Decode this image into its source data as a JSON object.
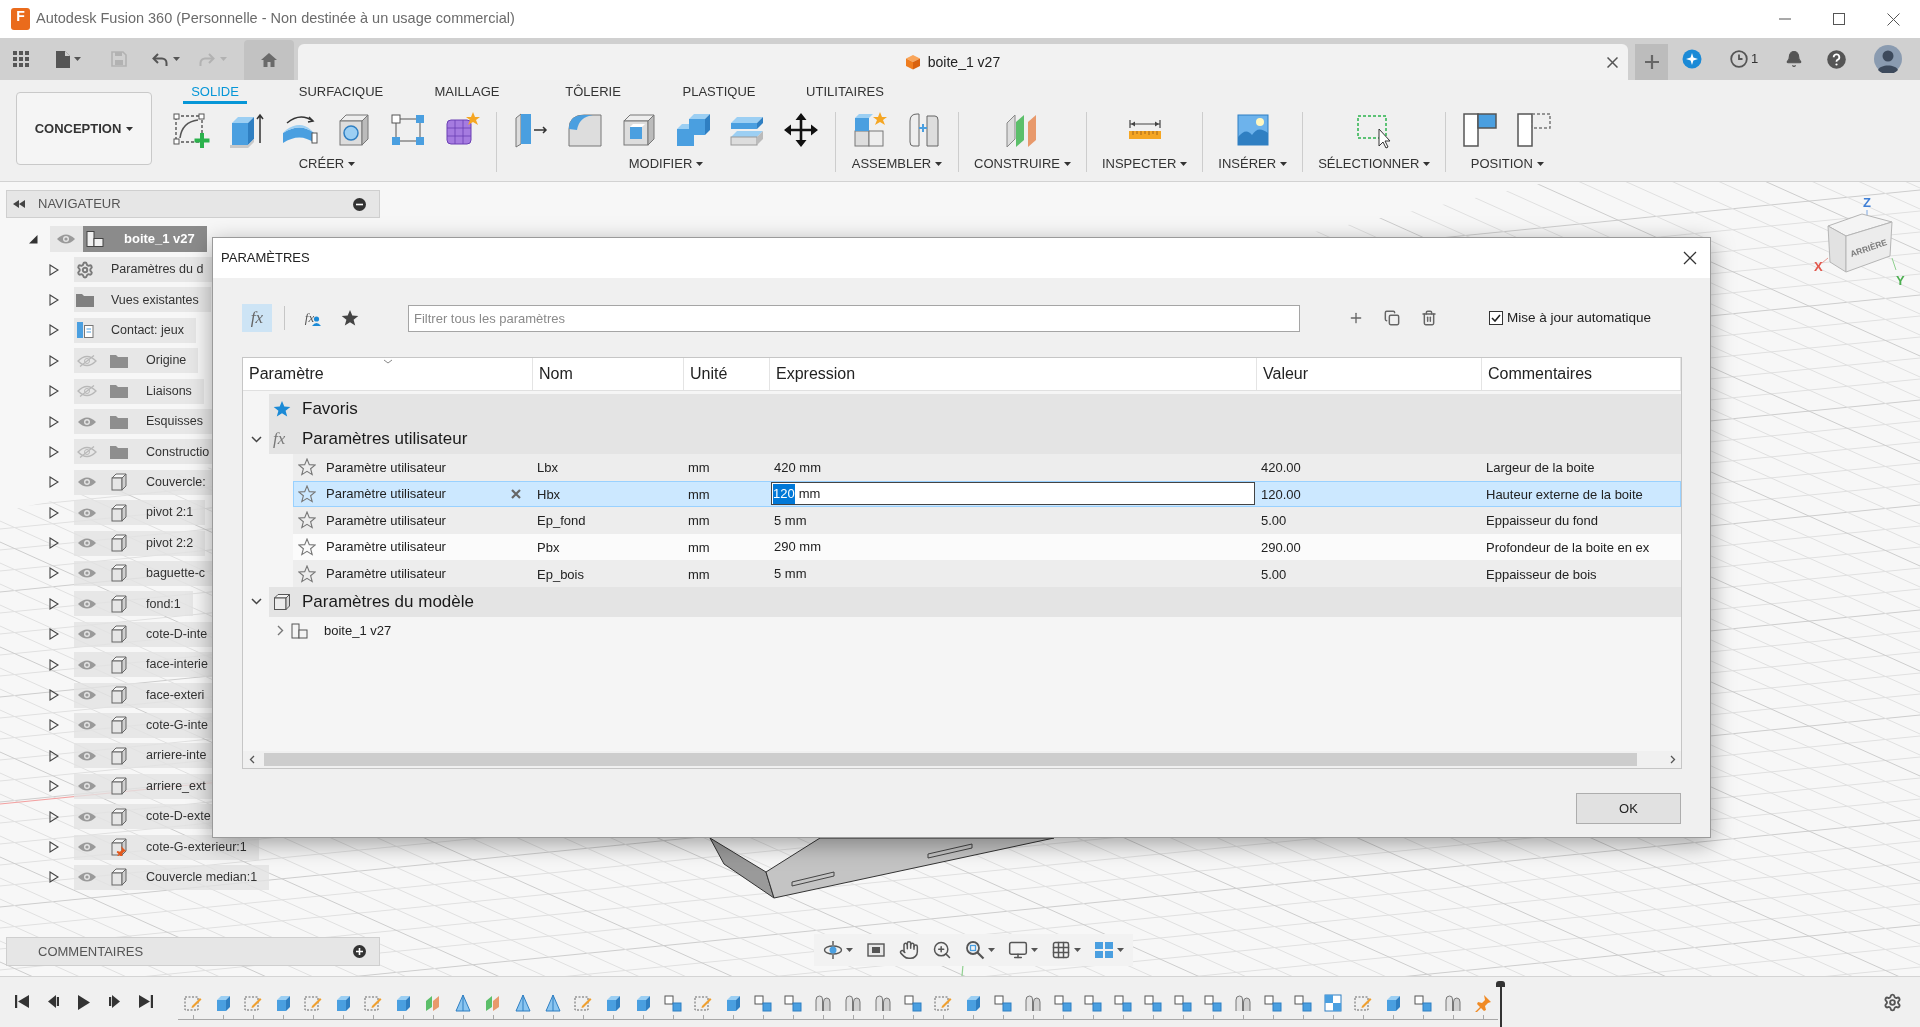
{
  "window": {
    "title": "Autodesk Fusion 360 (Personnelle - Non destinée à un usage commercial)",
    "logo_letter": "F"
  },
  "quick_access": [
    {
      "kind": "apps",
      "disabled": false
    },
    {
      "kind": "file",
      "disabled": false
    },
    {
      "kind": "save",
      "disabled": true
    },
    {
      "kind": "undo",
      "disabled": false
    },
    {
      "kind": "redo",
      "disabled": true
    }
  ],
  "document_tab": {
    "title": "boite_1 v27"
  },
  "job_status": {
    "count": "1"
  },
  "workspace_button": {
    "label": "CONCEPTION"
  },
  "ribbon_tabs": [
    {
      "label": "SOLIDE",
      "selected": true
    },
    {
      "label": "SURFACIQUE",
      "selected": false
    },
    {
      "label": "MAILLAGE",
      "selected": false
    },
    {
      "label": "TÔLERIE",
      "selected": false
    },
    {
      "label": "PLASTIQUE",
      "selected": false
    },
    {
      "label": "UTILITAIRES",
      "selected": false
    }
  ],
  "tool_groups": [
    {
      "label": "CRÉER",
      "tools": [
        {
          "kind": "sketch"
        },
        {
          "kind": "extrude"
        },
        {
          "kind": "revolve"
        },
        {
          "kind": "hole"
        },
        {
          "kind": "pattern"
        },
        {
          "kind": "form"
        }
      ]
    },
    {
      "label": "MODIFIER",
      "tools": [
        {
          "kind": "presspull"
        },
        {
          "kind": "fillet"
        },
        {
          "kind": "shell"
        },
        {
          "kind": "combine"
        },
        {
          "kind": "offset"
        },
        {
          "kind": "move"
        }
      ]
    },
    {
      "label": "ASSEMBLER",
      "tools": [
        {
          "kind": "component"
        },
        {
          "kind": "joint"
        }
      ]
    },
    {
      "label": "CONSTRUIRE",
      "tools": [
        {
          "kind": "plane"
        }
      ]
    },
    {
      "label": "INSPECTER",
      "tools": [
        {
          "kind": "measure"
        }
      ]
    },
    {
      "label": "INSÉRER",
      "tools": [
        {
          "kind": "image"
        }
      ]
    },
    {
      "label": "SÉLECTIONNER",
      "tools": [
        {
          "kind": "select"
        }
      ]
    },
    {
      "label": "POSITION",
      "tools": [
        {
          "kind": "capture"
        },
        {
          "kind": "revert"
        }
      ]
    }
  ],
  "navigator": {
    "title": "NAVIGATEUR",
    "root": {
      "label": "boite_1 v27",
      "expanded": true,
      "active": true,
      "visible": true,
      "children": [
        {
          "kind": "settings",
          "label": "Paramètres du d",
          "expanded": false
        },
        {
          "kind": "views",
          "label": "Vues existantes",
          "expanded": false
        },
        {
          "kind": "contact",
          "label": "Contact: jeux",
          "expanded": false
        },
        {
          "kind": "folder",
          "label": "Origine",
          "expanded": false,
          "visible": false
        },
        {
          "kind": "folder",
          "label": "Liaisons",
          "expanded": false,
          "visible": false
        },
        {
          "kind": "folder",
          "label": "Esquisses",
          "expanded": false,
          "visible": true
        },
        {
          "kind": "folder",
          "label": "Constructio",
          "expanded": false,
          "visible": false
        },
        {
          "kind": "body",
          "label": "Couvercle:",
          "expanded": false,
          "visible": true
        },
        {
          "kind": "body",
          "label": "pivot 2:1",
          "expanded": false,
          "visible": true
        },
        {
          "kind": "body",
          "label": "pivot 2:2",
          "expanded": false,
          "visible": true
        },
        {
          "kind": "body",
          "label": "baguette-c",
          "expanded": false,
          "visible": true
        },
        {
          "kind": "body",
          "label": "fond:1",
          "expanded": false,
          "visible": true
        },
        {
          "kind": "body",
          "label": "cote-D-inte",
          "expanded": false,
          "visible": true
        },
        {
          "kind": "body",
          "label": "face-interie",
          "expanded": false,
          "visible": true
        },
        {
          "kind": "body",
          "label": "face-exteri",
          "expanded": false,
          "visible": true
        },
        {
          "kind": "body",
          "label": "cote-G-inte",
          "expanded": false,
          "visible": true
        },
        {
          "kind": "body",
          "label": "arriere-inte",
          "expanded": false,
          "visible": true
        },
        {
          "kind": "body",
          "label": "arriere_ext",
          "expanded": false,
          "visible": true
        },
        {
          "kind": "body",
          "label": "cote-D-exte",
          "expanded": false,
          "visible": true
        },
        {
          "kind": "pinned",
          "label": "cote-G-exterieur:1",
          "expanded": false,
          "visible": true
        },
        {
          "kind": "body",
          "label": "Couvercle median:1",
          "expanded": false,
          "visible": true
        }
      ]
    }
  },
  "view_cube": {
    "face": "ARRIÈRE",
    "axes": [
      {
        "label": "Z",
        "color": "#3f7fd6"
      },
      {
        "label": "X",
        "color": "#e2574c"
      },
      {
        "label": "Y",
        "color": "#4caf50"
      }
    ]
  },
  "parameters_dialog": {
    "title": "PARAMÈTRES",
    "filter_buttons": [
      {
        "kind": "all",
        "glyph": "fx",
        "selected": true
      },
      {
        "kind": "user",
        "glyph": "fx",
        "selected": false
      },
      {
        "kind": "favorites",
        "selected": false
      }
    ],
    "filter_field": {
      "placeholder": "Filtrer tous les paramètres"
    },
    "auto_update": {
      "label": "Mise à jour automatique",
      "checked": true
    },
    "columns": [
      {
        "label": "Paramètre",
        "sorted": true
      },
      {
        "label": "Nom",
        "sorted": false
      },
      {
        "label": "Unité",
        "sorted": false
      },
      {
        "label": "Expression",
        "sorted": false
      },
      {
        "label": "Valeur",
        "sorted": false
      },
      {
        "label": "Commentaires",
        "sorted": false
      }
    ],
    "groups": [
      {
        "kind": "favorites",
        "label": "Favoris"
      },
      {
        "kind": "user",
        "label": "Paramètres utilisateur",
        "glyph": "fx",
        "expanded": true,
        "rows": [
          {
            "parameter": "Paramètre utilisateur",
            "name": "Lbx",
            "unit": "mm",
            "expression_parts": [
              {
                "text": "420 mm",
                "selected": false
              }
            ],
            "value": "420.00",
            "comment": "Largeur de la boite",
            "favorite": false,
            "selected": false,
            "hovered": false,
            "editing": false
          },
          {
            "parameter": "Paramètre utilisateur",
            "name": "Hbx",
            "unit": "mm",
            "expression_parts": [
              {
                "text": "120",
                "selected": true
              },
              {
                "text": "mm",
                "selected": false
              }
            ],
            "value": "120.00",
            "comment": "Hauteur externe de la boite",
            "favorite": false,
            "selected": true,
            "hovered": false,
            "editing": true
          },
          {
            "parameter": "Paramètre utilisateur",
            "name": "Ep_fond",
            "unit": "mm",
            "expression_parts": [
              {
                "text": "5 mm",
                "selected": false
              }
            ],
            "value": "5.00",
            "comment": "Eppaisseur du fond",
            "favorite": false,
            "selected": false,
            "hovered": false,
            "editing": false
          },
          {
            "parameter": "Paramètre utilisateur",
            "name": "Pbx",
            "unit": "mm",
            "expression_parts": [
              {
                "text": "290 mm",
                "selected": false
              }
            ],
            "value": "290.00",
            "comment": "Profondeur de la boite en ex",
            "favorite": false,
            "selected": false,
            "hovered": true,
            "editing": false
          },
          {
            "parameter": "Paramètre utilisateur",
            "name": "Ep_bois",
            "unit": "mm",
            "expression_parts": [
              {
                "text": "5 mm",
                "selected": false
              }
            ],
            "value": "5.00",
            "comment": "Eppaisseur de bois",
            "favorite": false,
            "selected": false,
            "hovered": false,
            "editing": false
          }
        ]
      },
      {
        "kind": "model",
        "label": "Paramètres du modèle",
        "expanded": true,
        "children": [
          {
            "label": "boite_1 v27",
            "expanded": false
          }
        ]
      }
    ],
    "ok_button": "OK"
  },
  "comments_panel": {
    "title": "COMMENTAIRES"
  },
  "view_tools": [
    {
      "kind": "orbit",
      "dropdown": true
    },
    {
      "kind": "look",
      "dropdown": false
    },
    {
      "kind": "pan",
      "dropdown": false
    },
    {
      "kind": "zoom",
      "dropdown": false
    },
    {
      "kind": "fit",
      "dropdown": true
    },
    {
      "kind": "display",
      "dropdown": true
    },
    {
      "kind": "grid",
      "dropdown": true
    },
    {
      "kind": "viewports",
      "dropdown": true
    }
  ],
  "timeline": {
    "features": [
      {
        "kind": "sketch"
      },
      {
        "kind": "extrude"
      },
      {
        "kind": "sketch"
      },
      {
        "kind": "extrude"
      },
      {
        "kind": "sketch"
      },
      {
        "kind": "extrude"
      },
      {
        "kind": "sketch"
      },
      {
        "kind": "extrude"
      },
      {
        "kind": "plane"
      },
      {
        "kind": "axis"
      },
      {
        "kind": "plane"
      },
      {
        "kind": "axis"
      },
      {
        "kind": "axis"
      },
      {
        "kind": "sketch"
      },
      {
        "kind": "extrude"
      },
      {
        "kind": "extrude"
      },
      {
        "kind": "joint"
      },
      {
        "kind": "sketch"
      },
      {
        "kind": "extrude"
      },
      {
        "kind": "joint"
      },
      {
        "kind": "joint"
      },
      {
        "kind": "motion"
      },
      {
        "kind": "motion"
      },
      {
        "kind": "motion"
      },
      {
        "kind": "joint"
      },
      {
        "kind": "sketch"
      },
      {
        "kind": "extrude"
      },
      {
        "kind": "joint"
      },
      {
        "kind": "motion"
      },
      {
        "kind": "joint"
      },
      {
        "kind": "joint"
      },
      {
        "kind": "joint"
      },
      {
        "kind": "joint"
      },
      {
        "kind": "joint"
      },
      {
        "kind": "joint"
      },
      {
        "kind": "motion"
      },
      {
        "kind": "joint"
      },
      {
        "kind": "joint"
      },
      {
        "kind": "split"
      },
      {
        "kind": "sketch"
      },
      {
        "kind": "extrude"
      },
      {
        "kind": "joint"
      },
      {
        "kind": "motion"
      },
      {
        "kind": "pin"
      }
    ]
  }
}
